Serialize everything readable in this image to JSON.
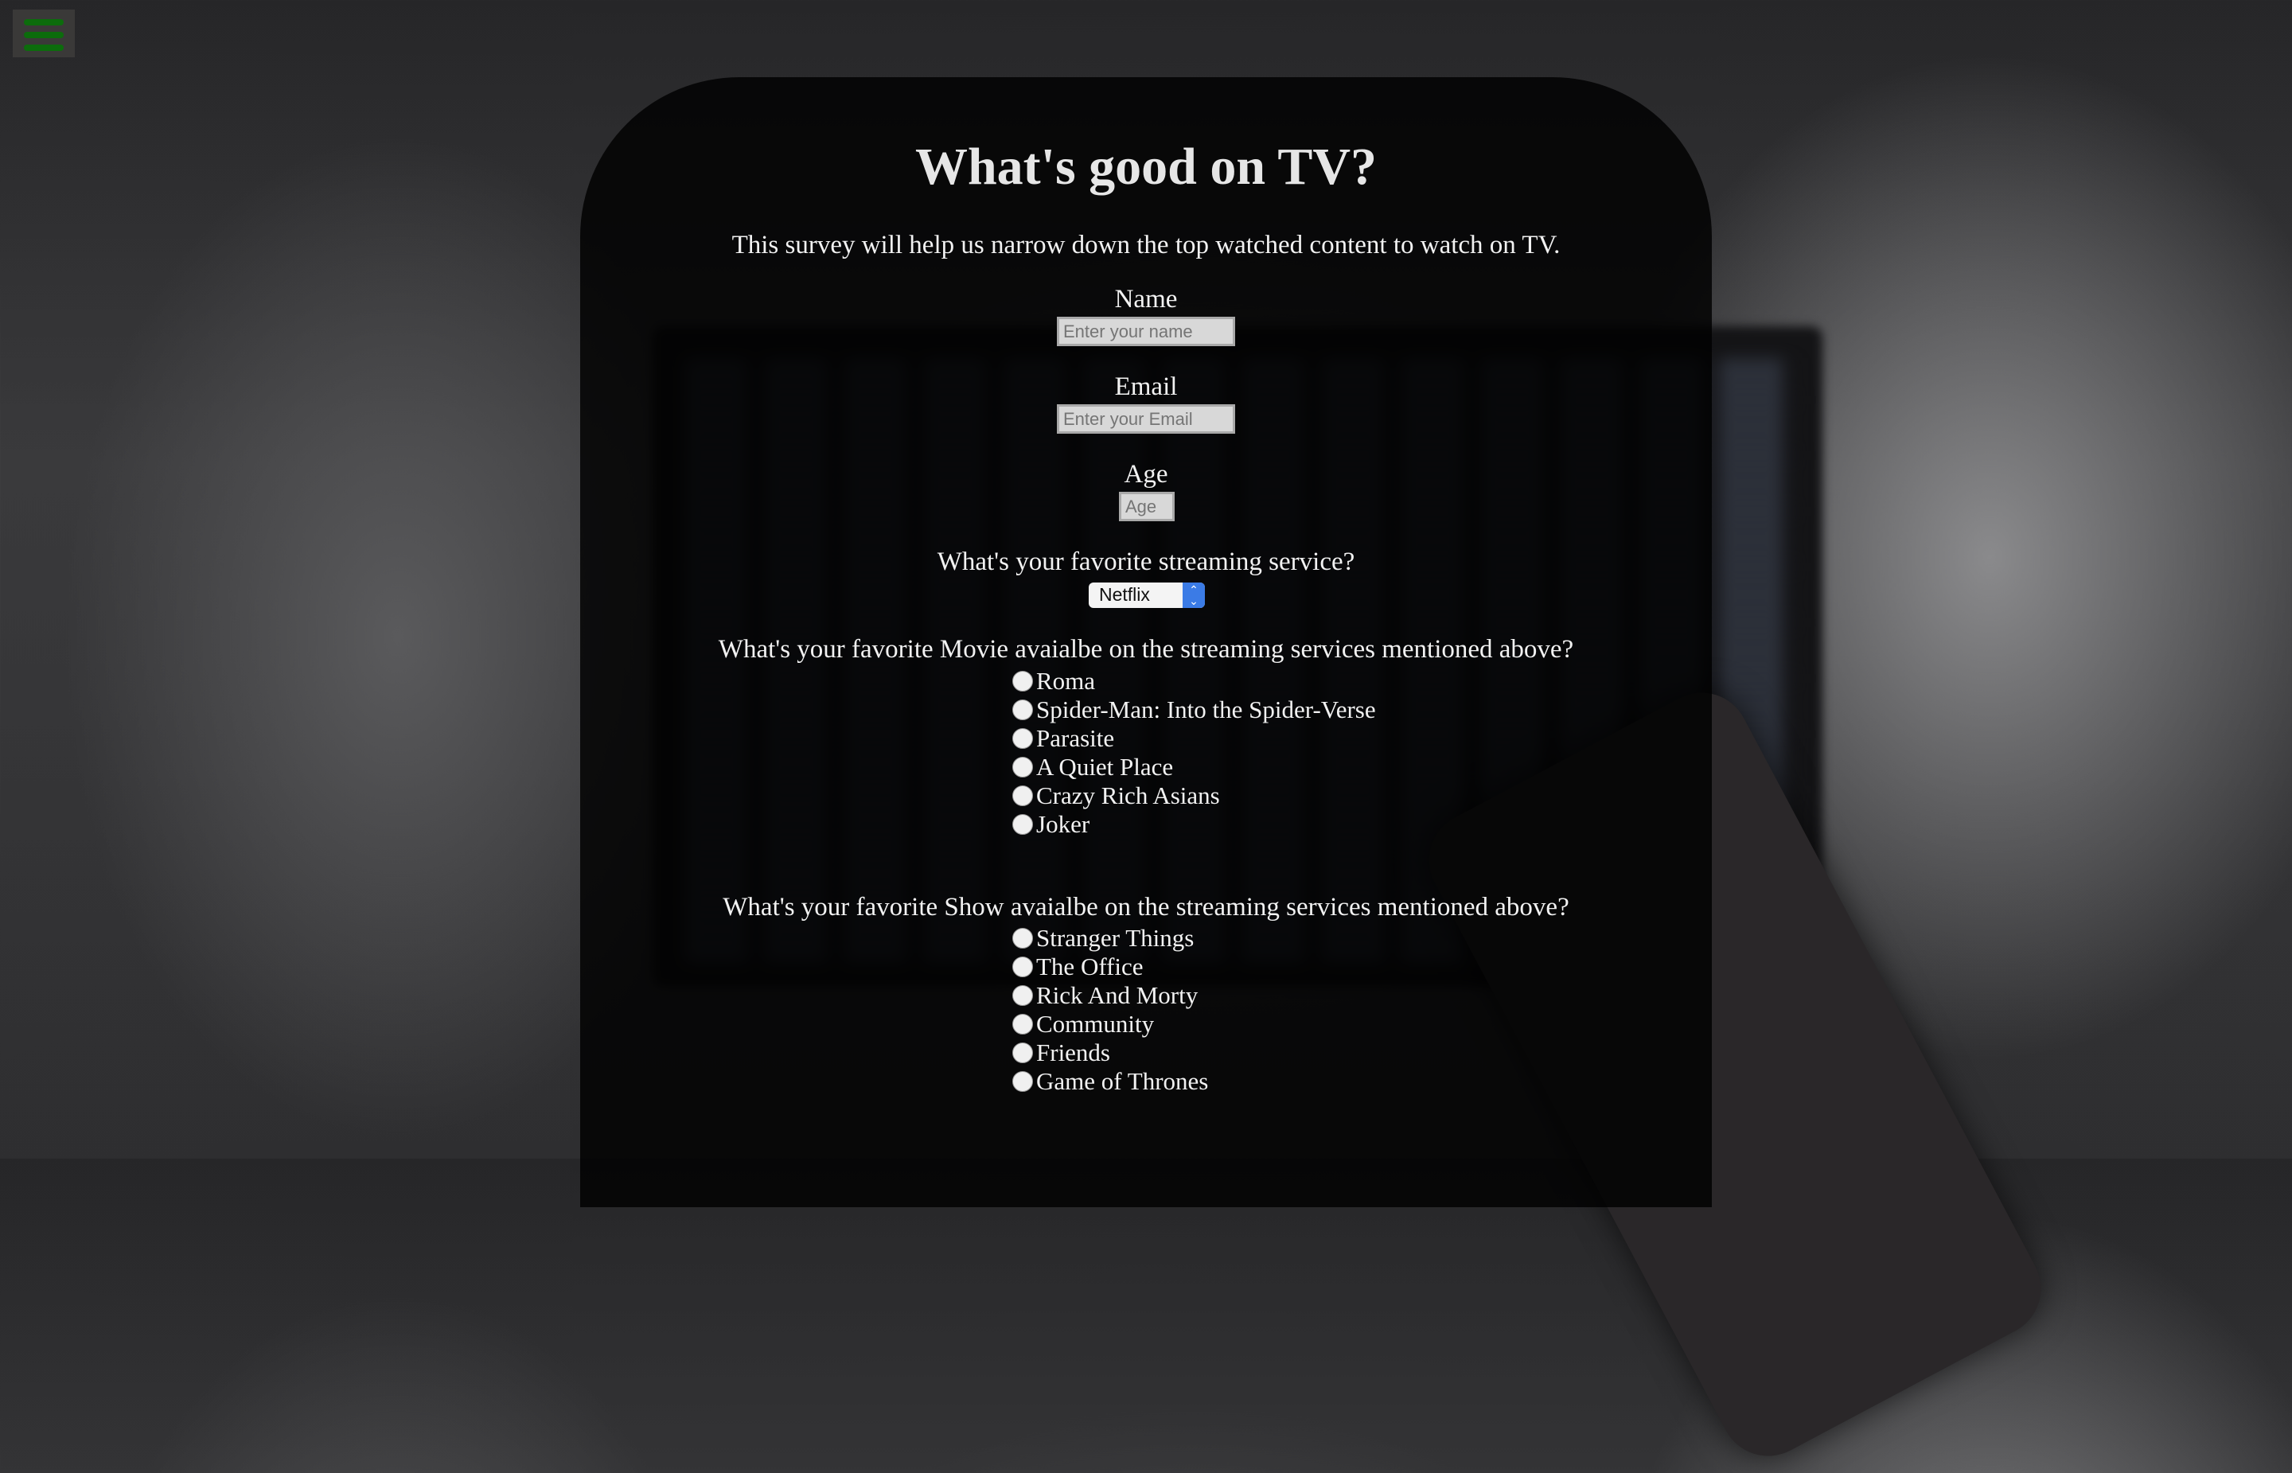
{
  "menu": {
    "icon": "hamburger-menu-icon"
  },
  "title": "What's good on TV?",
  "subtitle": "This survey will help us narrow down the top watched content to watch on TV.",
  "name": {
    "label": "Name",
    "placeholder": "Enter your name"
  },
  "email": {
    "label": "Email",
    "placeholder": "Enter your Email"
  },
  "age": {
    "label": "Age",
    "placeholder": "Age"
  },
  "streaming": {
    "label": "What's your favorite streaming service?",
    "selected": "Netflix"
  },
  "movie": {
    "label": "What's your favorite Movie avaialbe on the streaming services mentioned above?",
    "options": [
      "Roma",
      "Spider-Man: Into the Spider-Verse",
      "Parasite",
      "A Quiet Place",
      "Crazy Rich Asians",
      "Joker"
    ]
  },
  "show": {
    "label": "What's your favorite Show avaialbe on the streaming services mentioned above?",
    "options": [
      "Stranger Things",
      "The Office",
      "Rick And Morty",
      "Community",
      "Friends",
      "Game of Thrones"
    ]
  },
  "colors": {
    "menu_icon": "#0c6c0c",
    "select_accent": "#3b7be6"
  }
}
